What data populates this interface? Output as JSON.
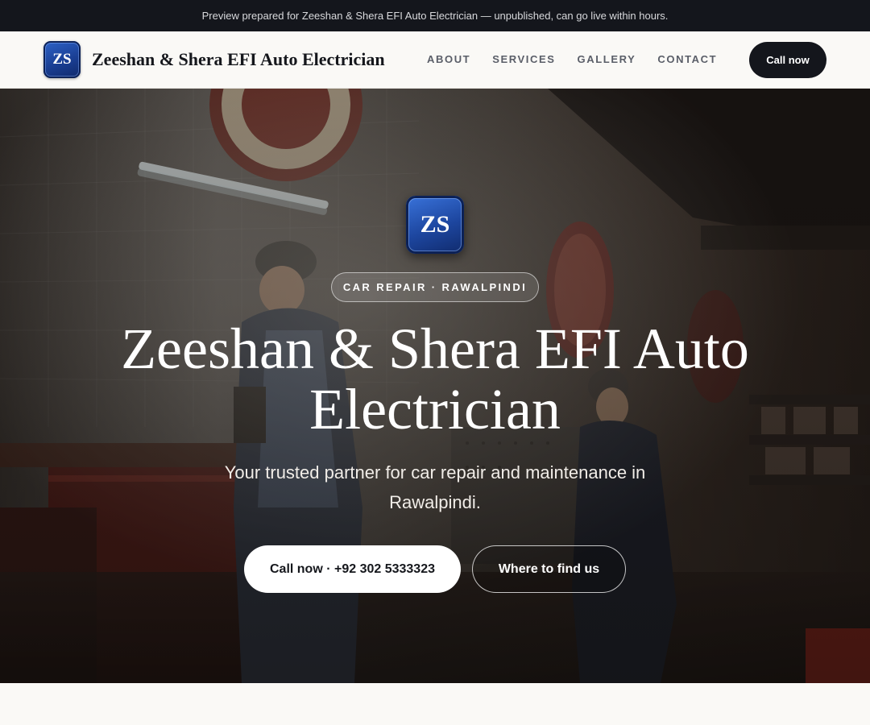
{
  "topbar": {
    "notice": "Preview prepared for Zeeshan & Shera EFI Auto Electrician — unpublished, can go live within hours."
  },
  "nav": {
    "logo_text": "ZS",
    "brand": "Zeeshan & Shera EFI Auto Electrician",
    "links": [
      "ABOUT",
      "SERVICES",
      "GALLERY",
      "CONTACT"
    ],
    "cta": "Call now"
  },
  "hero": {
    "logo_text": "ZS",
    "eyebrow": "CAR REPAIR · RAWALPINDI",
    "title": "Zeeshan & Shera EFI Auto Electrician",
    "subtitle": "Your trusted partner for car repair and maintenance in Rawalpindi.",
    "primary_cta": "Call now · +92 302 5333323",
    "secondary_cta": "Where to find us",
    "background": "garage-workshop-photo"
  },
  "colors": {
    "dark": "#14161c",
    "page_bg": "#faf9f6",
    "logo_blue": "#1a3f94",
    "white": "#ffffff"
  }
}
